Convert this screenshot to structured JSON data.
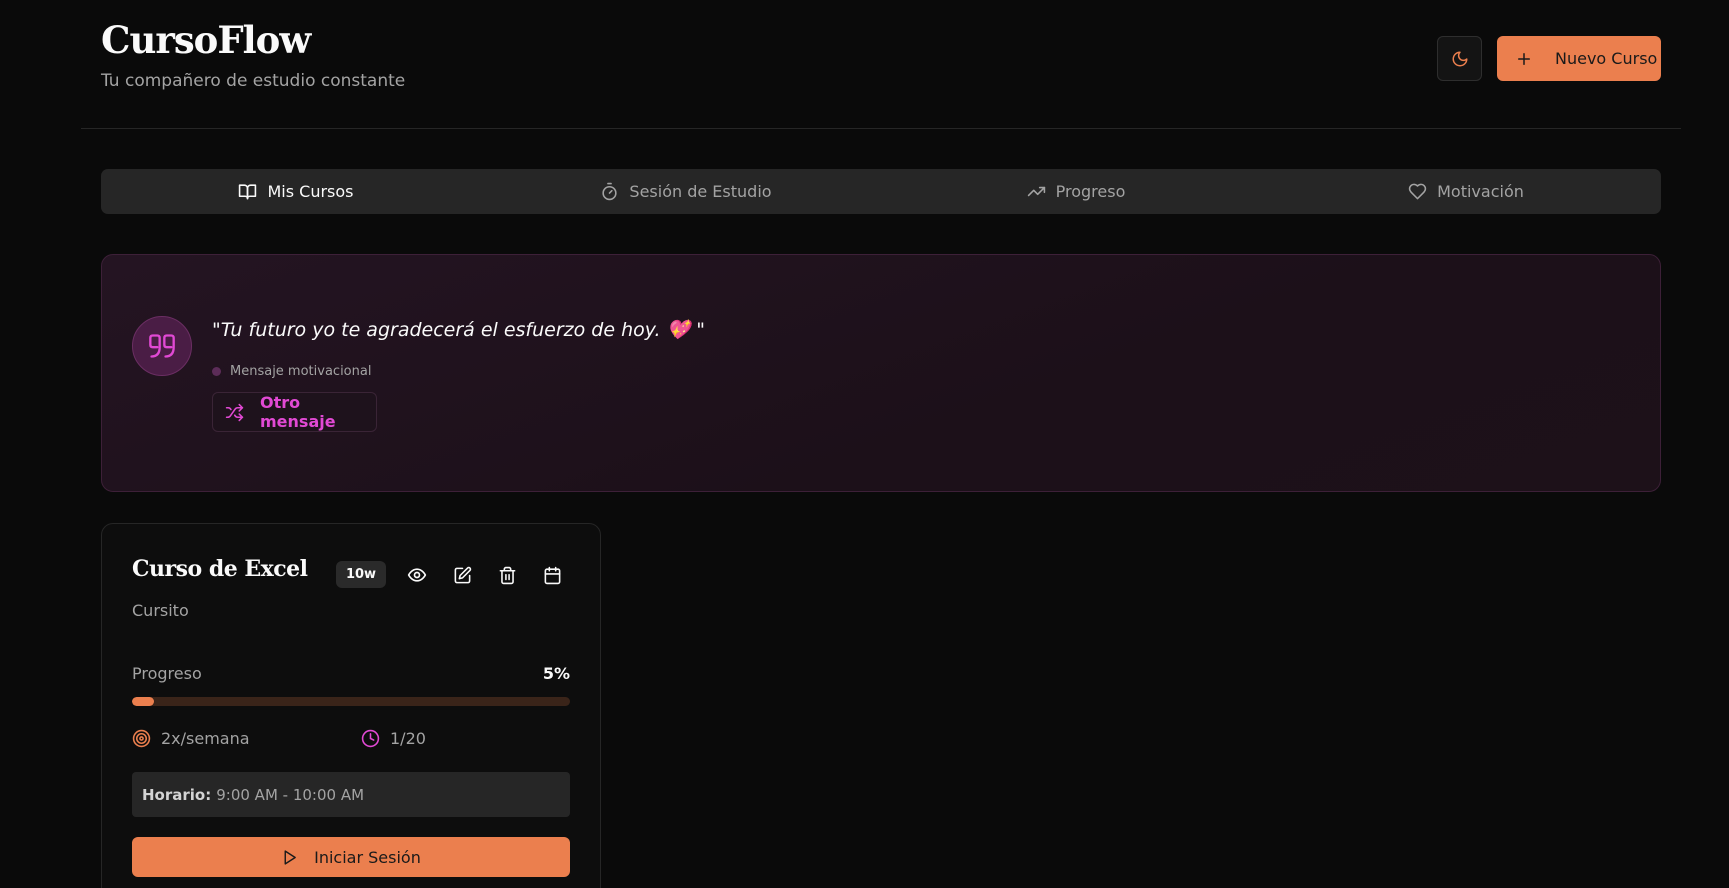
{
  "header": {
    "title": "CursoFlow",
    "subtitle": "Tu compañero de estudio constante",
    "theme_icon": "moon-icon",
    "new_course_label": "Nuevo Curso"
  },
  "tabs": [
    {
      "label": "Mis Cursos",
      "icon": "book-open-icon",
      "active": true
    },
    {
      "label": "Sesión de Estudio",
      "icon": "timer-icon",
      "active": false
    },
    {
      "label": "Progreso",
      "icon": "trending-up-icon",
      "active": false
    },
    {
      "label": "Motivación",
      "icon": "heart-icon",
      "active": false
    }
  ],
  "motivation": {
    "quote": "\"Tu futuro yo te agradecerá el esfuerzo de hoy. 💖 \"",
    "meta_label": "Mensaje motivacional",
    "button_label": "Otro mensaje"
  },
  "course": {
    "title": "Curso de Excel",
    "badge": "10w",
    "description": "Cursito",
    "progress_label": "Progreso",
    "progress_text": "5%",
    "progress_fraction": 0.05,
    "frequency": "2x/semana",
    "sessions": "1/20",
    "schedule_label": "Horario:",
    "schedule_value": "9:00 AM - 10:00 AM",
    "start_label": "Iniciar Sesión"
  },
  "colors": {
    "accent": "#eb7f4e",
    "pink": "#e149d4",
    "background": "#0a0a0a"
  }
}
